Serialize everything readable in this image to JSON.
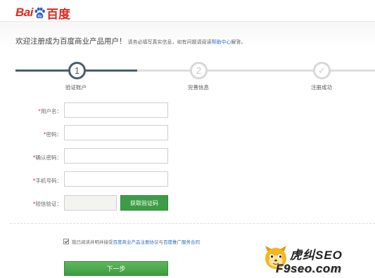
{
  "brand": {
    "left": "Bai",
    "right": "百度",
    "color": "#de2a20"
  },
  "welcome": {
    "title": "欢迎注册成为百度商业产品用户！",
    "hint": "请务必填写真实信息，如有问题请阅读",
    "help_link": "帮助中心",
    "hint_end": "解答。"
  },
  "steps": [
    {
      "number": "1",
      "label": "验证账户",
      "state": "active"
    },
    {
      "number": "2",
      "label": "完善信息",
      "state": "pending"
    },
    {
      "number": "✓",
      "label": "注册成功",
      "state": "pending"
    }
  ],
  "form": {
    "required_mark": "*",
    "username_label": "用户名：",
    "password_label": "密码：",
    "confirm_label": "确认密码：",
    "phone_label": "手机号码：",
    "sms_label": "短信验证：",
    "username_value": "",
    "password_value": "",
    "confirm_value": "",
    "phone_value": "",
    "sms_value": "",
    "sms_button": "获取验证码"
  },
  "agreement": {
    "checked": true,
    "prefix": "我已阅读并明并接受",
    "link1": "百度商业产品注册协议",
    "middle": "与",
    "link2": "百度推广服务合同"
  },
  "next_button": "下一步",
  "watermark": {
    "top": "虎纠SEO",
    "bottom": "F9seo.com"
  },
  "colors": {
    "accent": "#4d5b74",
    "button_green": "#3d9c46",
    "link": "#2a6fc4"
  }
}
